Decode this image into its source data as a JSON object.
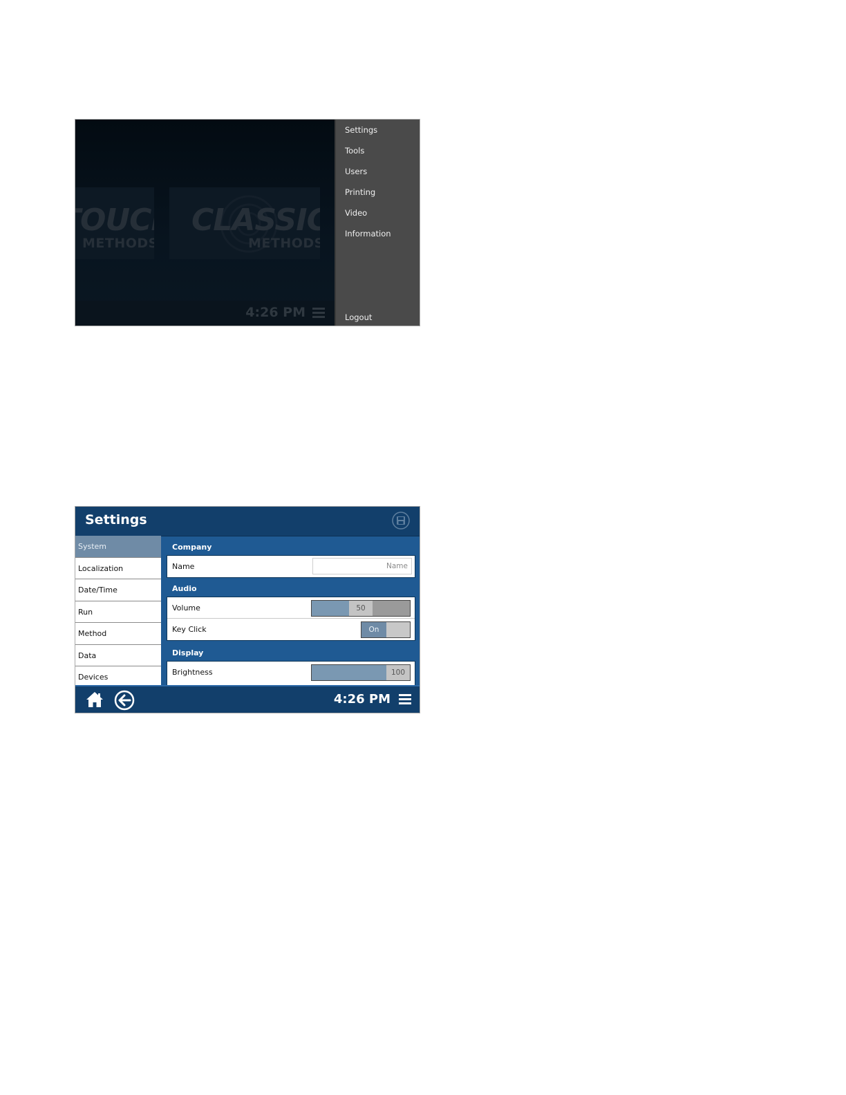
{
  "home": {
    "tiles": [
      {
        "title": "TOUCH",
        "subtitle": "METHODS"
      },
      {
        "title": "CLASSIC",
        "subtitle": "METHODS"
      }
    ],
    "time": "4:26 PM",
    "menu": {
      "items": [
        "Settings",
        "Tools",
        "Users",
        "Printing",
        "Video",
        "Information"
      ],
      "logout": "Logout"
    }
  },
  "settings": {
    "title": "Settings",
    "sidebar": [
      "System",
      "Localization",
      "Date/Time",
      "Run",
      "Method",
      "Data",
      "Devices"
    ],
    "selected": "System",
    "sections": {
      "company": {
        "title": "Company",
        "name_label": "Name",
        "name_placeholder": "Name",
        "name_value": ""
      },
      "audio": {
        "title": "Audio",
        "volume_label": "Volume",
        "volume_value": "50",
        "volume_level": 50,
        "keyclick_label": "Key Click",
        "keyclick_value": "On"
      },
      "display": {
        "title": "Display",
        "brightness_label": "Brightness",
        "brightness_value": "100",
        "brightness_level": 100
      }
    },
    "footer": {
      "time": "4:26 PM"
    }
  }
}
